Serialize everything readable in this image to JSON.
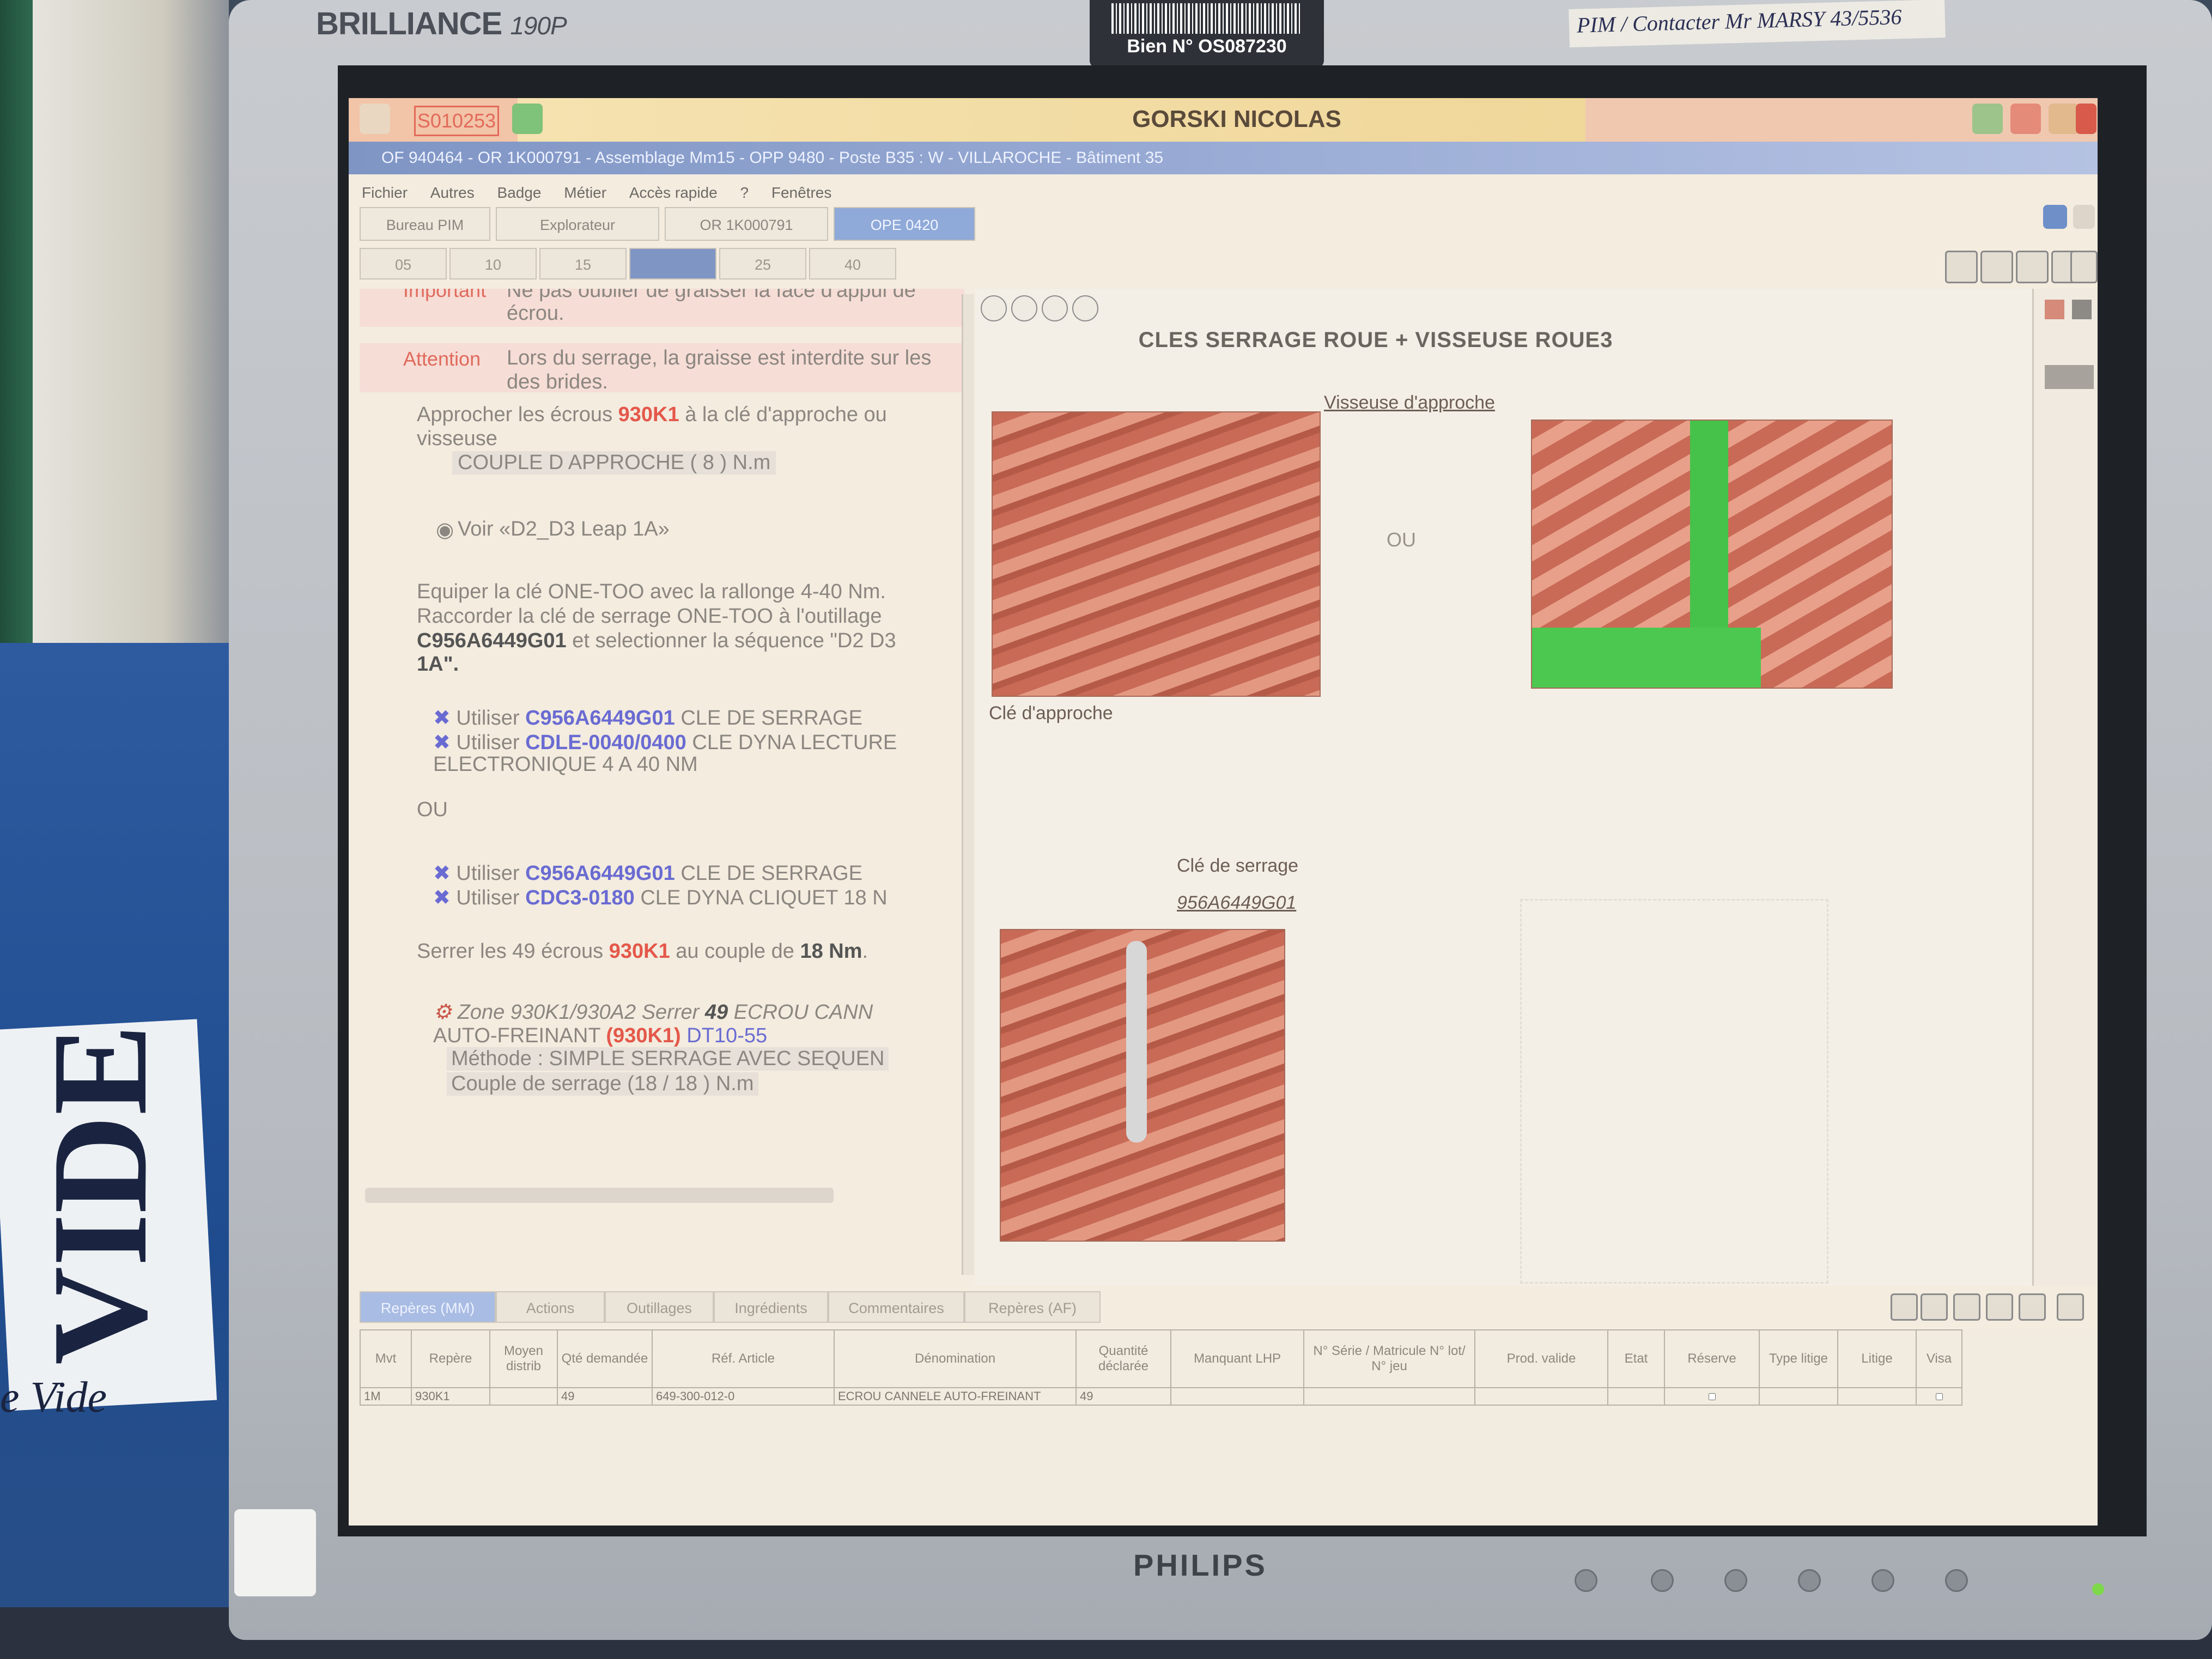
{
  "monitor": {
    "brand_top": "BRILLIANCE",
    "model": "190P",
    "brand_bottom": "PHILIPS",
    "asset_label": "Bien N° OS087230",
    "note": "PIM / Contacter Mr MARSY 43/5536"
  },
  "desk": {
    "sign_word": "VIDE",
    "sign_sub": "e Vide"
  },
  "app": {
    "badge": "S010253",
    "user": "GORSKI NICOLAS",
    "path": "OF 940464 - OR 1K000791 - Assemblage Mm15 - OPP 9480 - Poste B35 : W - VILLAROCHE - Bâtiment 35",
    "menu": [
      "Fichier",
      "Autres",
      "Badge",
      "Métier",
      "Accès rapide",
      "?",
      "Fenêtres"
    ],
    "tabs": [
      "Bureau PIM",
      "Explorateur",
      "OR 1K000791",
      "OPE 0420"
    ],
    "steps": [
      "05",
      "10",
      "15",
      "",
      "25",
      "40"
    ]
  },
  "instructions": {
    "important_label": "Important",
    "important_text_1": "Ne pas oublier de graisser la face d'appui de",
    "important_text_2": "écrou.",
    "attention_label": "Attention",
    "attention_text_1": "Lors du serrage, la graisse est interdite sur les",
    "attention_text_2": "des brides.",
    "step1_a": "Approcher les écrous",
    "step1_part": "930K1",
    "step1_b": "à la clé d'approche ou",
    "step1_c": "visseuse",
    "step1_torque": "COUPLE D APPROCHE ( 8 ) N.m",
    "voir": "Voir «D2_D3 Leap 1A»",
    "step2_l1": "Equiper la clé ONE-TOO avec la rallonge 4-40 Nm.",
    "step2_l2": "Raccorder la clé de serrage ONE-TOO à l'outillage",
    "step2_tool": "C956A6449G01",
    "step2_l3b": "et selectionner la séquence \"D2 D3",
    "step2_l4": "1A\".",
    "use_label": "Utiliser",
    "tool1_ref": "C956A6449G01",
    "tool1_name": "CLE DE SERRAGE",
    "tool2_ref": "CDLE-0040/0400",
    "tool2_name": "CLE DYNA LECTURE",
    "tool2_cont": "ELECTRONIQUE 4 A 40 NM",
    "ou": "OU",
    "tool3_ref": "C956A6449G01",
    "tool3_name": "CLE DE SERRAGE",
    "tool4_ref": "CDC3-0180",
    "tool4_name": "CLE DYNA CLIQUET 18 N",
    "step3_a": "Serrer les 49 écrous",
    "step3_part": "930K1",
    "step3_b": "au couple de",
    "step3_val": "18 Nm",
    "zone_text": "Zone 930K1/930A2 Serrer",
    "zone_qty": "49",
    "zone_item": "ECROU CANN",
    "zone_l2a": "AUTO-FREINANT",
    "zone_part": "(930K1)",
    "zone_dt": "DT10-55",
    "method": "Méthode : SIMPLE SERRAGE AVEC SEQUEN",
    "couple": "Couple de serrage   (18 / 18 ) N.m"
  },
  "figure": {
    "title": "CLES SERRAGE ROUE + VISSEUSE ROUE3",
    "label_visseuse": "Visseuse d'approche",
    "label_cle_approche": "Clé d'approche",
    "label_cle_serrage": "Clé de serrage",
    "label_ref": "956A6449G01",
    "ou": "OU"
  },
  "bottom_tabs": [
    "Repères (MM)",
    "Actions",
    "Outillages",
    "Ingrédients",
    "Commentaires",
    "Repères (AF)"
  ],
  "table": {
    "headers": [
      "Mvt",
      "Repère",
      "Moyen distrib",
      "Qté demandée",
      "Réf. Article",
      "Dénomination",
      "Quantité déclarée",
      "Manquant LHP",
      "N° Série / Matricule N° lot/ N° jeu",
      "Prod. valide",
      "Etat",
      "Réserve",
      "Type litige",
      "Litige",
      "Visa"
    ],
    "rows": [
      [
        "1M",
        "930K1",
        "",
        "49",
        "649-300-012-0",
        "ECROU CANNELE AUTO-FREINANT",
        "49",
        "",
        "",
        "",
        "",
        "",
        "",
        "",
        ""
      ]
    ]
  },
  "colors": {
    "accent": "#7f95c4",
    "warning_red": "#e4584a",
    "tool_blue": "#6a6bd2"
  }
}
